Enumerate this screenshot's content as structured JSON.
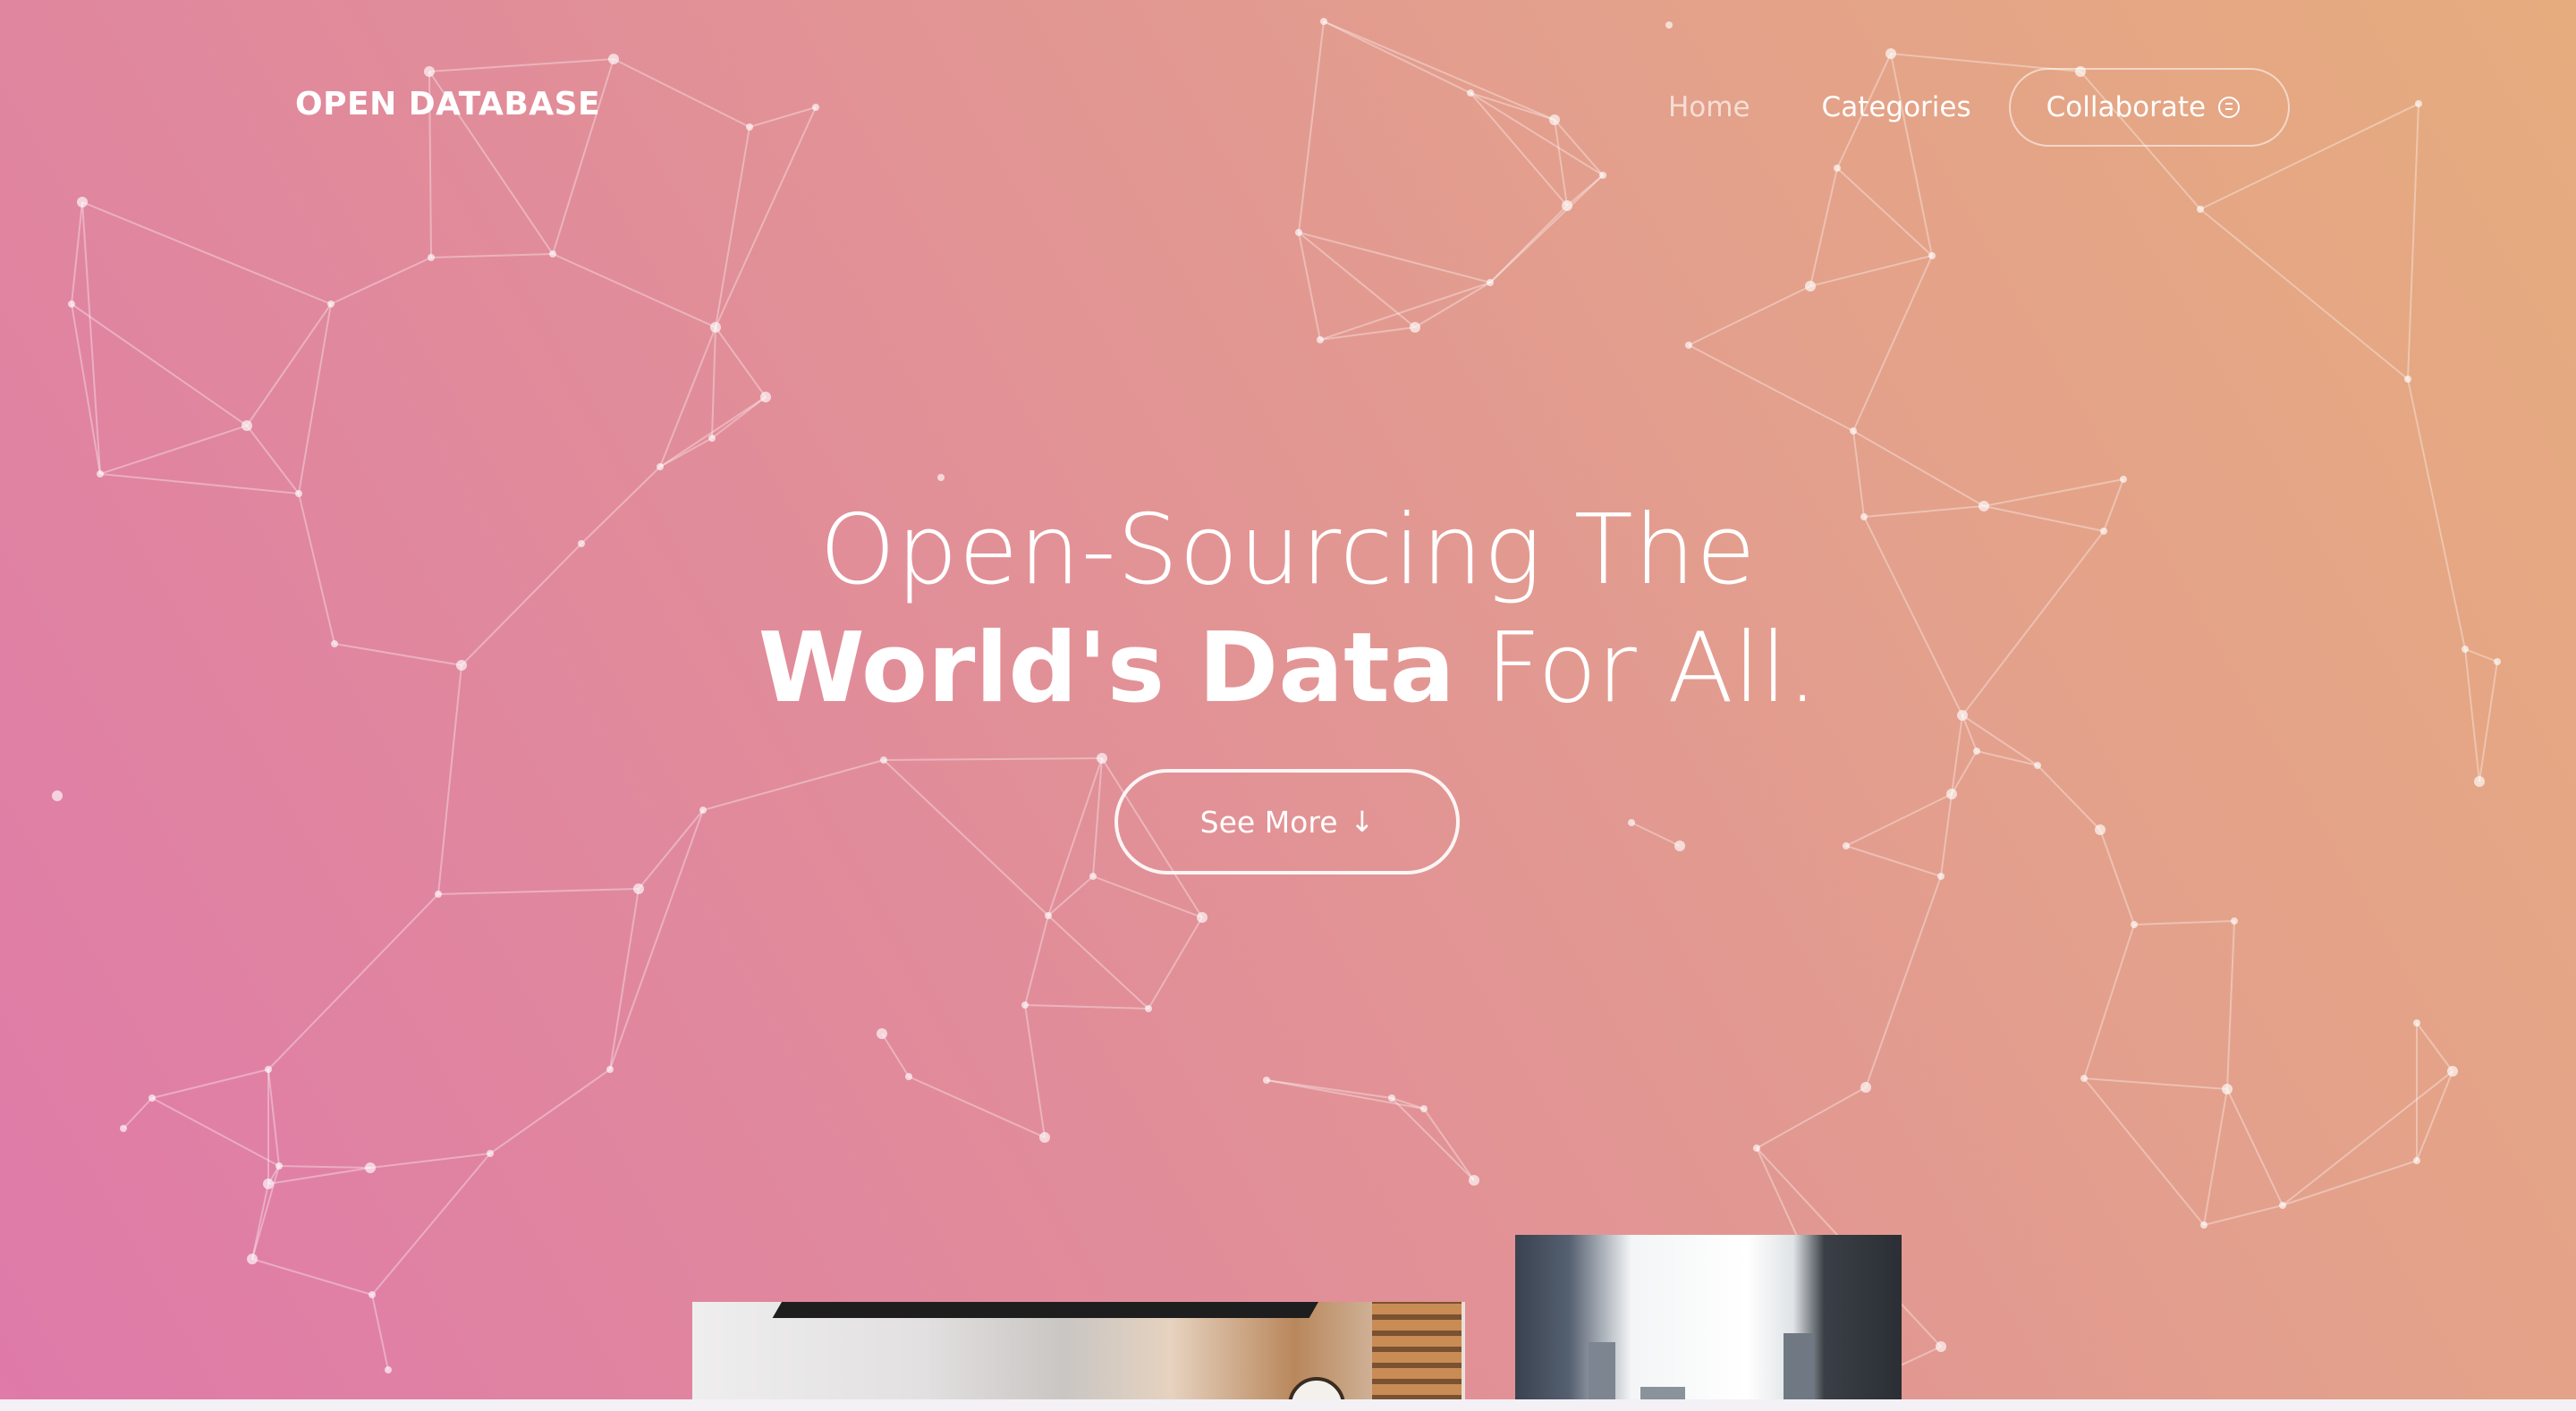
{
  "header": {
    "brand": "OPEN DATABASE",
    "nav": {
      "home_label": "Home",
      "categories_label": "Categories",
      "collaborate_label": "Collaborate",
      "collaborate_icon": "chat-bubble-icon"
    }
  },
  "hero": {
    "headline_line1": "Open-Sourcing The",
    "headline_bold": "World's Data",
    "headline_light": "For All.",
    "see_more_label": "See More",
    "see_more_icon": "arrow-down-icon",
    "background": {
      "gradient_start": "#df7aa9",
      "gradient_end": "#e6ac7e",
      "network_color": "#ffffff"
    }
  },
  "gallery": {
    "images": [
      "interior-photo",
      "building-photo",
      "dark-photo"
    ]
  }
}
